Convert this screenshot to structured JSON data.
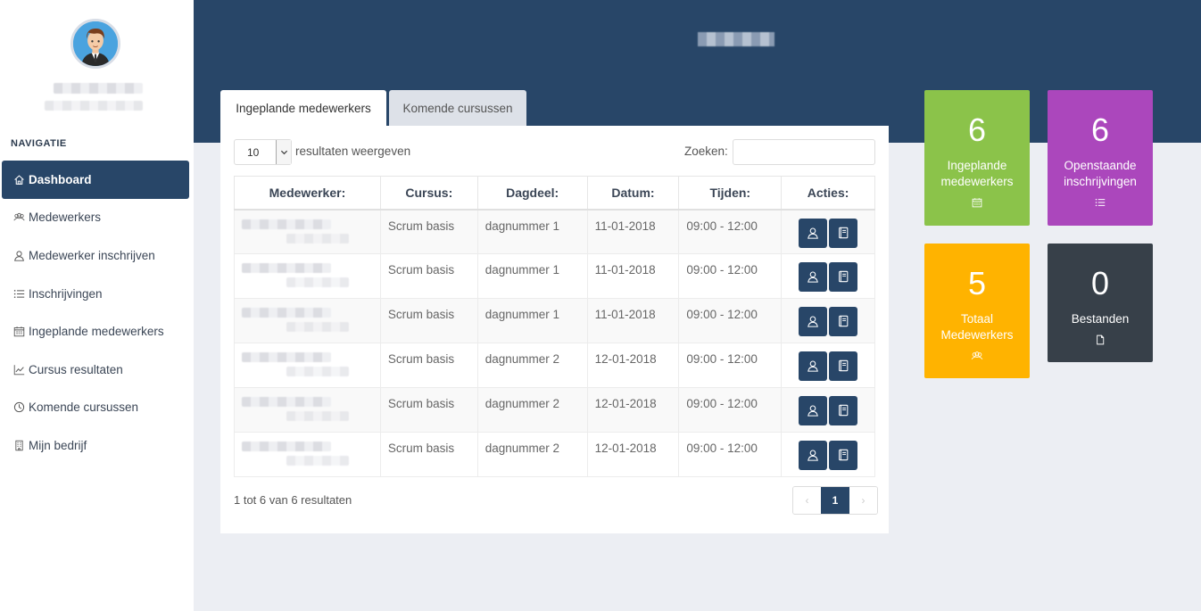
{
  "sidebar": {
    "nav_title": "NAVIGATIE",
    "items": [
      {
        "label": "Dashboard",
        "icon": "home-icon",
        "active": true
      },
      {
        "label": "Medewerkers",
        "icon": "users-icon"
      },
      {
        "label": "Medewerker inschrijven",
        "icon": "user-icon"
      },
      {
        "label": "Inschrijvingen",
        "icon": "list-icon"
      },
      {
        "label": "Ingeplande medewerkers",
        "icon": "calendar-icon"
      },
      {
        "label": "Cursus resultaten",
        "icon": "chart-icon"
      },
      {
        "label": "Komende cursussen",
        "icon": "clock-icon"
      },
      {
        "label": "Mijn bedrijf",
        "icon": "building-icon"
      }
    ]
  },
  "tabs": [
    {
      "label": "Ingeplande medewerkers",
      "active": true
    },
    {
      "label": "Komende cursussen",
      "active": false
    }
  ],
  "table_controls": {
    "length_value": "10",
    "length_label": "resultaten weergeven",
    "search_label": "Zoeken:"
  },
  "table": {
    "headers": [
      "Medewerker:",
      "Cursus:",
      "Dagdeel:",
      "Datum:",
      "Tijden:",
      "Acties:"
    ],
    "rows": [
      {
        "course": "Scrum basis",
        "daypart": "dagnummer 1",
        "date": "11-01-2018",
        "times": "09:00 - 12:00"
      },
      {
        "course": "Scrum basis",
        "daypart": "dagnummer 1",
        "date": "11-01-2018",
        "times": "09:00 - 12:00"
      },
      {
        "course": "Scrum basis",
        "daypart": "dagnummer 1",
        "date": "11-01-2018",
        "times": "09:00 - 12:00"
      },
      {
        "course": "Scrum basis",
        "daypart": "dagnummer 2",
        "date": "12-01-2018",
        "times": "09:00 - 12:00"
      },
      {
        "course": "Scrum basis",
        "daypart": "dagnummer 2",
        "date": "12-01-2018",
        "times": "09:00 - 12:00"
      },
      {
        "course": "Scrum basis",
        "daypart": "dagnummer 2",
        "date": "12-01-2018",
        "times": "09:00 - 12:00"
      }
    ]
  },
  "table_footer": {
    "info": "1 tot 6 van 6 resultaten",
    "prev": "‹",
    "current_page": "1",
    "next": "›"
  },
  "tiles": [
    {
      "value": "6",
      "label_line1": "Ingeplande",
      "label_line2": "medewerkers",
      "icon": "calendar-icon",
      "color": "#8bc34a"
    },
    {
      "value": "6",
      "label_line1": "Openstaande",
      "label_line2": "inschrijvingen",
      "icon": "list-icon",
      "color": "#ab47bc"
    },
    {
      "value": "5",
      "label_line1": "Totaal",
      "label_line2": "Medewerkers",
      "icon": "users-icon",
      "color": "#ffb300"
    },
    {
      "value": "0",
      "label_line1": "Bestanden",
      "label_line2": "",
      "icon": "file-icon",
      "color": "#374049"
    }
  ],
  "colors": {
    "primary": "#284668",
    "background": "#eceef3"
  }
}
